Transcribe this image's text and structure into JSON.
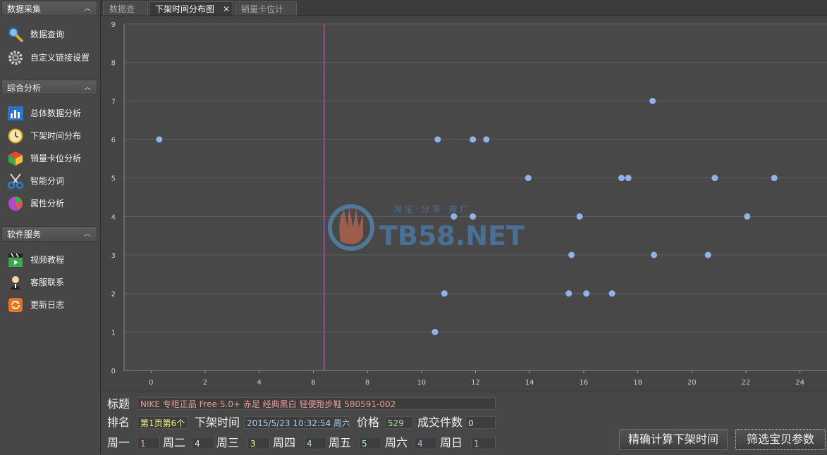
{
  "sidebar": {
    "sections": [
      {
        "title": "数据采集",
        "items": [
          {
            "label": "数据查询",
            "icon": "magnifier-icon"
          },
          {
            "label": "自定义链接设置",
            "icon": "gear-icon"
          }
        ]
      },
      {
        "title": "综合分析",
        "items": [
          {
            "label": "总体数据分析",
            "icon": "bar-chart-icon"
          },
          {
            "label": "下架时间分布",
            "icon": "clock-icon"
          },
          {
            "label": "销量卡位分析",
            "icon": "cube-icon"
          },
          {
            "label": "智能分词",
            "icon": "scissors-icon"
          },
          {
            "label": "属性分析",
            "icon": "pie-chart-icon"
          }
        ]
      },
      {
        "title": "软件服务",
        "items": [
          {
            "label": "视频教程",
            "icon": "clapperboard-icon"
          },
          {
            "label": "客服联系",
            "icon": "support-person-icon"
          },
          {
            "label": "更新日志",
            "icon": "refresh-icon"
          }
        ]
      }
    ]
  },
  "tabs": [
    {
      "label": "数据查询",
      "active": false
    },
    {
      "label": "下架时间分布图",
      "active": true,
      "close": "✕"
    },
    {
      "label": "销量卡位计算",
      "active": false
    }
  ],
  "watermark": {
    "text": "TB58.NET",
    "subtext": "淘 宝 · 分 享 · 推 广"
  },
  "chart_data": {
    "type": "scatter",
    "xlim": [
      -1,
      25
    ],
    "ylim": [
      0,
      9
    ],
    "xticks": [
      "0",
      "2",
      "4",
      "6",
      "8",
      "10",
      "12",
      "14",
      "16",
      "18",
      "20",
      "22",
      "24"
    ],
    "yticks": [
      "0",
      "1",
      "2",
      "3",
      "4",
      "5",
      "6",
      "7",
      "8",
      "9"
    ],
    "marker_x": 6.4,
    "grid": true,
    "point_color": "#8fb3e6",
    "marker_color": "#c040c0",
    "points": [
      {
        "x": 0.3,
        "y": 6
      },
      {
        "x": 10.5,
        "y": 1
      },
      {
        "x": 10.6,
        "y": 6
      },
      {
        "x": 10.85,
        "y": 2
      },
      {
        "x": 11.2,
        "y": 4
      },
      {
        "x": 11.9,
        "y": 4
      },
      {
        "x": 11.9,
        "y": 6
      },
      {
        "x": 12.4,
        "y": 6
      },
      {
        "x": 13.95,
        "y": 5
      },
      {
        "x": 15.45,
        "y": 2
      },
      {
        "x": 15.55,
        "y": 3
      },
      {
        "x": 15.85,
        "y": 4
      },
      {
        "x": 16.1,
        "y": 2
      },
      {
        "x": 17.05,
        "y": 2
      },
      {
        "x": 17.4,
        "y": 5
      },
      {
        "x": 17.65,
        "y": 5
      },
      {
        "x": 18.55,
        "y": 7
      },
      {
        "x": 18.6,
        "y": 3
      },
      {
        "x": 20.6,
        "y": 3
      },
      {
        "x": 20.85,
        "y": 5
      },
      {
        "x": 22.05,
        "y": 4
      },
      {
        "x": 23.05,
        "y": 5
      }
    ]
  },
  "info": {
    "title_label": "标题",
    "title_value": "NIKE 专柜正品 Free 5.0+ 赤足 经典黑白 轻便跑步鞋 580591-002",
    "rank_label": "排名",
    "rank_value": "第1页第6个",
    "time_label": "下架时间",
    "time_value": "2015/5/23 10:32:54 周六",
    "price_label": "价格",
    "price_value": "529",
    "sales_label": "成交件数",
    "sales_value": "0",
    "days": [
      {
        "label": "周一",
        "value": "1"
      },
      {
        "label": "周二",
        "value": "4"
      },
      {
        "label": "周三",
        "value": "3"
      },
      {
        "label": "周四",
        "value": "4"
      },
      {
        "label": "周五",
        "value": "5"
      },
      {
        "label": "周六",
        "value": "4"
      },
      {
        "label": "周日",
        "value": "1"
      }
    ],
    "btn_calc": "精确计算下架时间",
    "btn_filter": "筛选宝贝参数"
  }
}
